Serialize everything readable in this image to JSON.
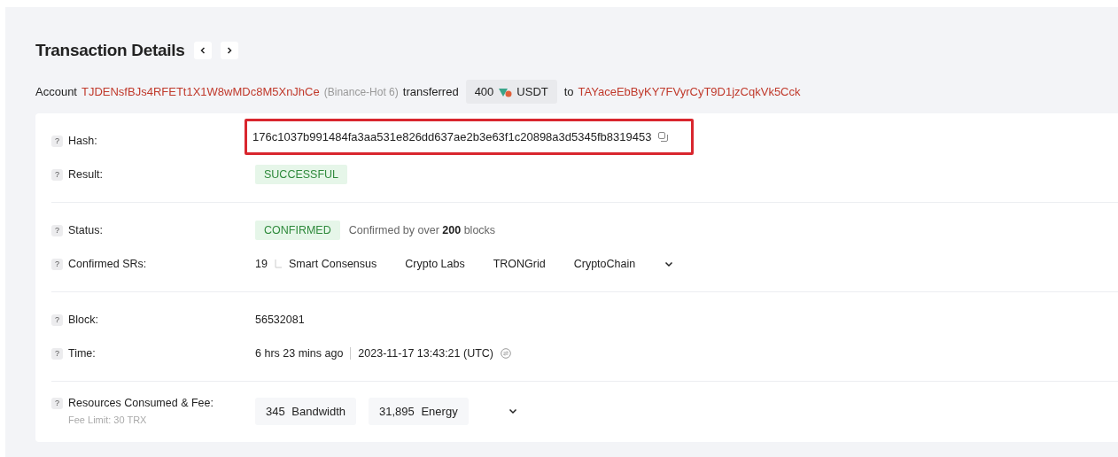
{
  "title": "Transaction Details",
  "summary": {
    "account_label": "Account",
    "from_address": "TJDENsfBJs4RFETt1X1W8wMDc8M5XnJhCe",
    "from_tag": "(Binance-Hot 6)",
    "verb": "transferred",
    "amount": "400",
    "token": "USDT",
    "to_label": "to",
    "to_address": "TAYaceEbByKY7FVyrCyT9D1jzCqkVk5Cck"
  },
  "help_mark": "?",
  "sections": [
    [
      {
        "kind": "hash",
        "label": "Hash:",
        "value": "176c1037b991484fa3aa531e826dd637ae2b3e63f1c20898a3d5345fb8319453",
        "highlighted": true
      },
      {
        "kind": "badge",
        "label": "Result:",
        "value": "SUCCESSFUL"
      }
    ],
    [
      {
        "kind": "status",
        "label": "Status:",
        "value": "CONFIRMED",
        "note_before": "Confirmed by over",
        "note_count": "200",
        "note_after": "blocks"
      },
      {
        "kind": "srs",
        "label": "Confirmed SRs:",
        "value": "19",
        "names": [
          "Smart Consensus",
          "Crypto Labs",
          "TRONGrid",
          "CryptoChain"
        ]
      }
    ],
    [
      {
        "kind": "text",
        "label": "Block:",
        "value": "56532081"
      },
      {
        "kind": "time",
        "label": "Time:",
        "value": "6 hrs 23 mins ago",
        "timestamp": "2023-11-17 13:43:21 (UTC)"
      }
    ],
    [
      {
        "kind": "resources",
        "label": "Resources Consumed & Fee:",
        "sublabel": "Fee Limit: 30 TRX",
        "resources": [
          {
            "amount": "345",
            "unit": "Bandwidth"
          },
          {
            "amount": "31,895",
            "unit": "Energy"
          }
        ]
      }
    ]
  ]
}
